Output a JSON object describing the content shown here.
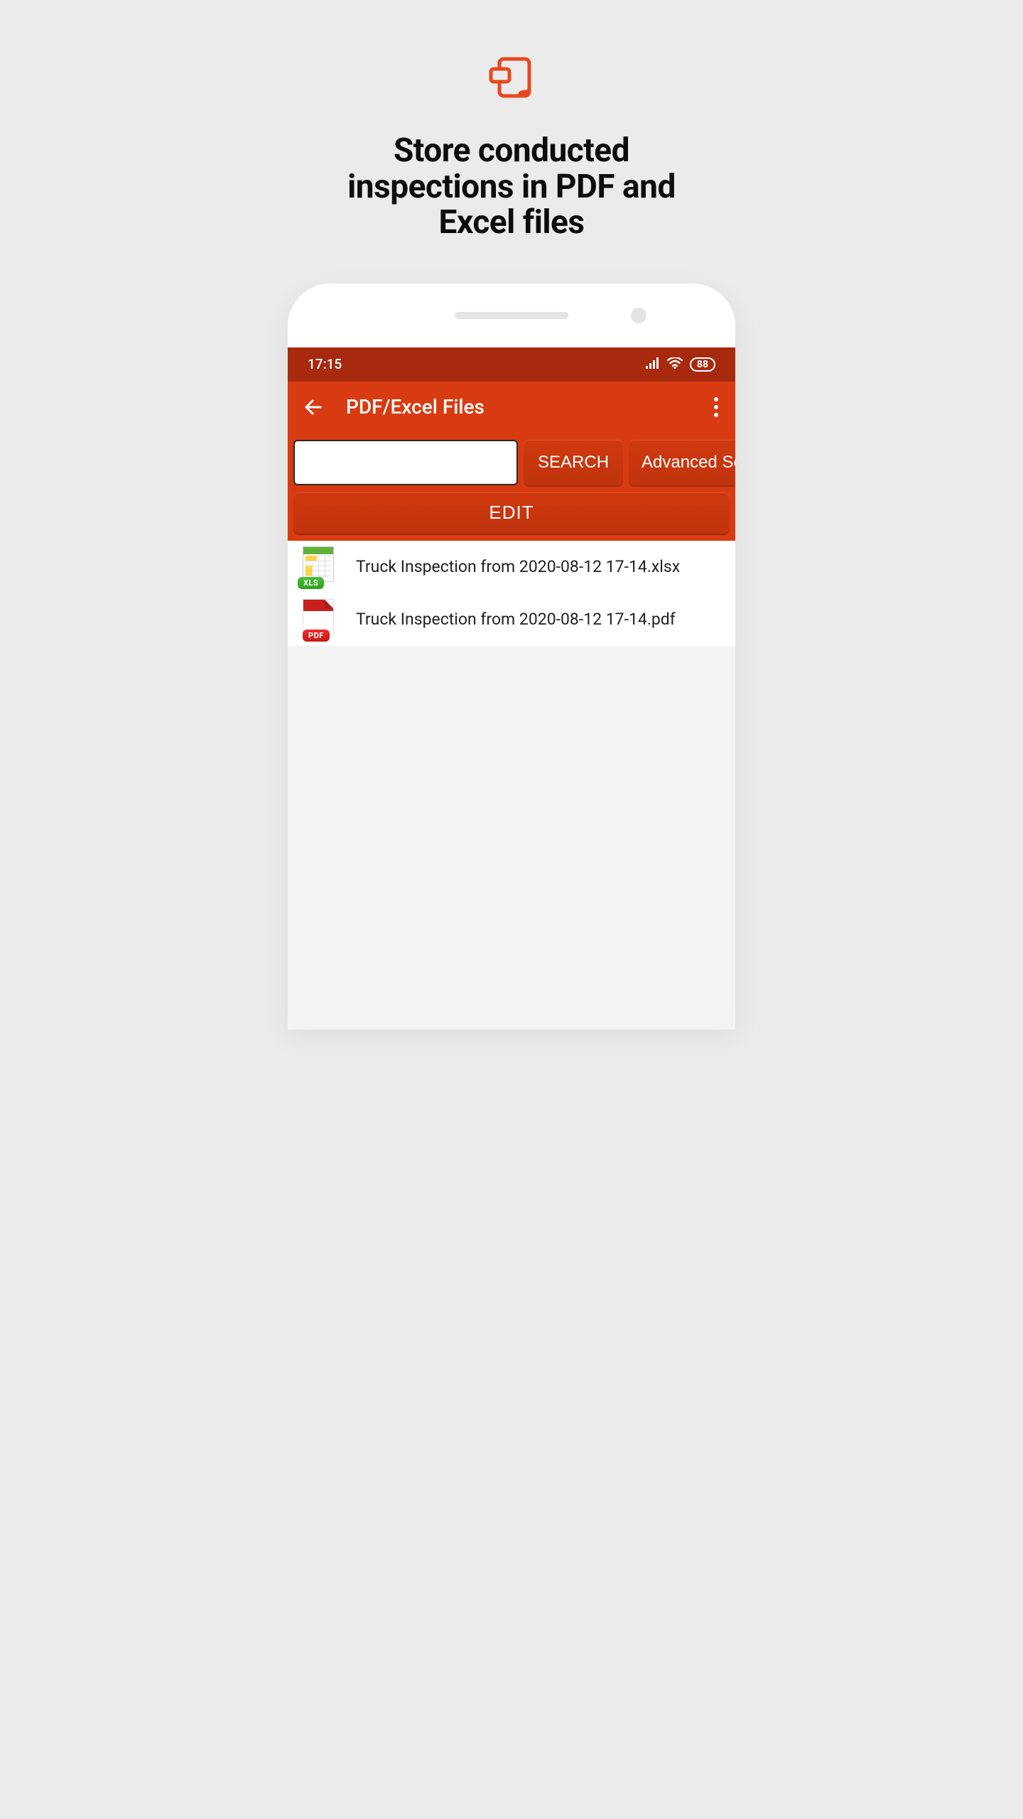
{
  "hero": {
    "title_l1": "Store conducted",
    "title_l2": "inspections in PDF and",
    "title_l3": "Excel files"
  },
  "status": {
    "time": "17:15",
    "battery": "88"
  },
  "appbar": {
    "title": "PDF/Excel Files"
  },
  "search": {
    "value": "",
    "search_label": "SEARCH",
    "advanced_label": "Advanced Search"
  },
  "edit": {
    "label": "EDIT"
  },
  "files": [
    {
      "name": "Truck Inspection from 2020-08-12 17-14.xlsx",
      "type": "xls",
      "badge": "XLS"
    },
    {
      "name": "Truck Inspection from 2020-08-12 17-14.pdf",
      "type": "pdf",
      "badge": "PDF"
    }
  ],
  "colors": {
    "accent": "#d83b12",
    "accent_dark": "#a72a0f"
  }
}
